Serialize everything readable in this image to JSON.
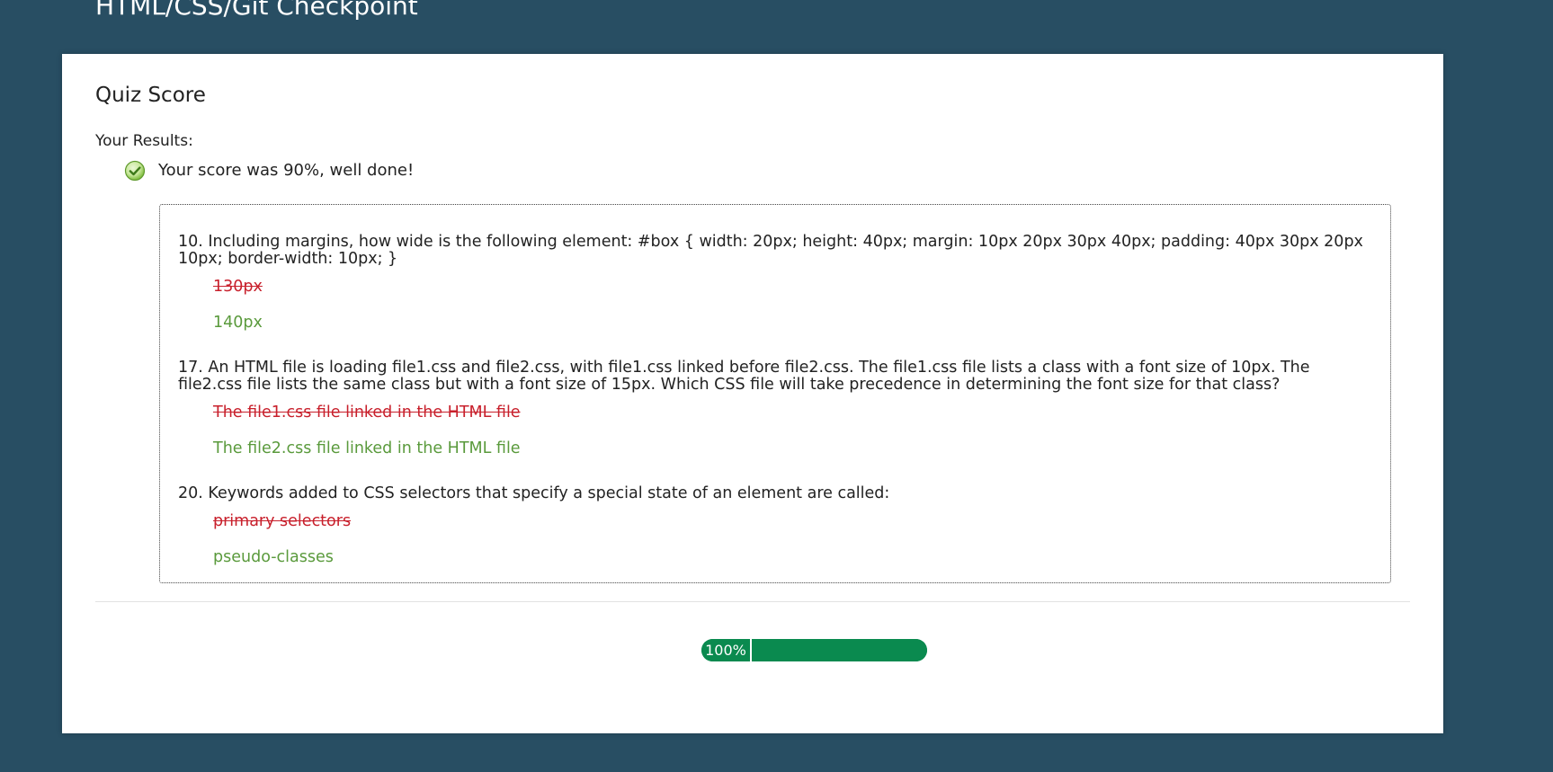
{
  "page": {
    "title": "HTML/CSS/Git Checkpoint"
  },
  "card": {
    "heading": "Quiz Score",
    "results_label": "Your Results:",
    "score_message": "Your score was 90%, well done!",
    "score_icon": "check-circle-icon"
  },
  "questions": [
    {
      "text": "10. Including margins, how wide is the following element: #box { width: 20px; height: 40px; margin: 10px 20px 30px 40px; padding: 40px 30px 20px 10px; border-width: 10px; }",
      "wrong_answer": "130px",
      "correct_answer": "140px"
    },
    {
      "text": "17. An HTML file is loading file1.css and file2.css, with file1.css linked before file2.css. The file1.css file lists a class with a font size of 10px. The file2.css file lists the same class but with a font size of 15px. Which CSS file will take precedence in determining the font size for that class?",
      "wrong_answer": "The file1.css file linked in the HTML file",
      "correct_answer": "The file2.css file linked in the HTML file"
    },
    {
      "text": "20.  Keywords added to CSS selectors that specify a special state of an element are called:",
      "wrong_answer": "primary selectors",
      "correct_answer": "pseudo-classes"
    }
  ],
  "progress": {
    "label": "100%",
    "fraction": 1.0
  },
  "colors": {
    "background": "#284e63",
    "wrong": "#c8202c",
    "correct": "#5a9a3c",
    "progress": "#0a8a4f",
    "check_icon": "#7cbb3b"
  }
}
